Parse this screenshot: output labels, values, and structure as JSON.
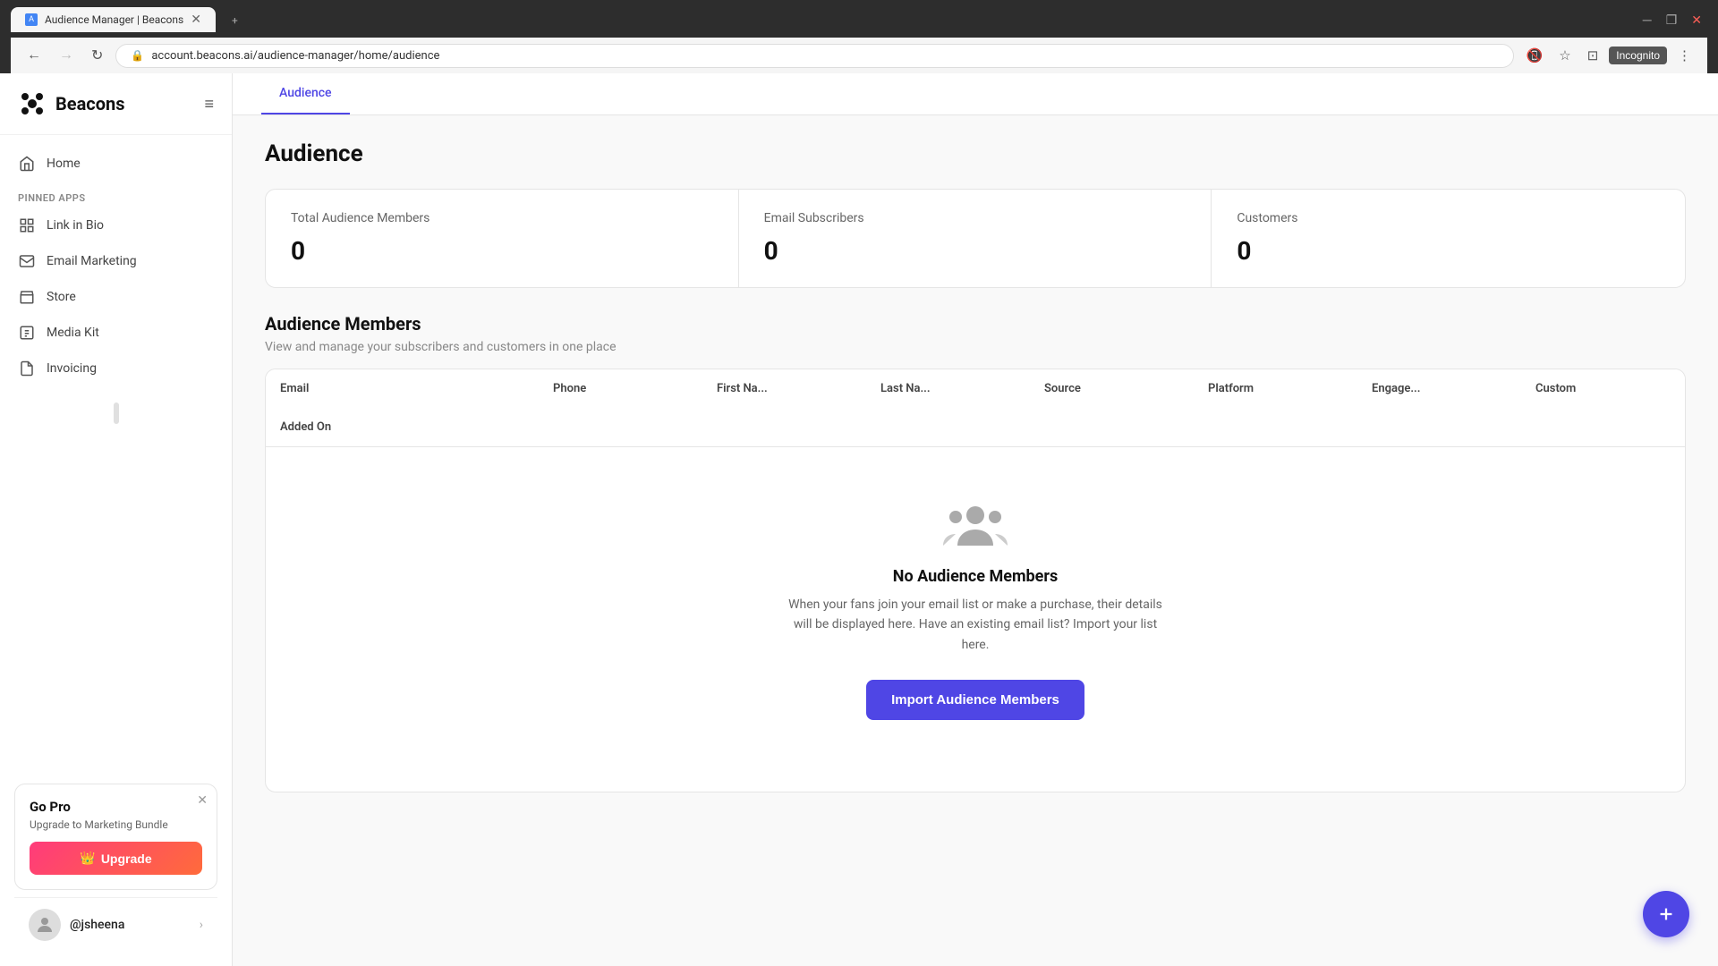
{
  "browser": {
    "tab_title": "Audience Manager | Beacons",
    "tab_favicon": "A",
    "url": "account.beacons.ai/audience-manager/home/audience",
    "incognito_label": "Incognito"
  },
  "sidebar": {
    "logo_text": "Beacons",
    "menu_toggle_icon": "≡",
    "pinned_label": "PINNED APPS",
    "nav_items": [
      {
        "id": "home",
        "label": "Home",
        "icon": "🏠"
      },
      {
        "id": "link-in-bio",
        "label": "Link in Bio",
        "icon": "⊞"
      },
      {
        "id": "email-marketing",
        "label": "Email Marketing",
        "icon": "✉"
      },
      {
        "id": "store",
        "label": "Store",
        "icon": "🏪"
      },
      {
        "id": "media-kit",
        "label": "Media Kit",
        "icon": "📋"
      },
      {
        "id": "invoicing",
        "label": "Invoicing",
        "icon": "📄"
      }
    ],
    "go_pro": {
      "title": "Go Pro",
      "subtitle": "Upgrade to Marketing Bundle",
      "upgrade_label": "Upgrade",
      "upgrade_icon": "👑"
    },
    "user": {
      "name": "@jsheena",
      "avatar_emoji": "👤"
    }
  },
  "top_nav": {
    "tabs": [
      {
        "id": "audience",
        "label": "Audience",
        "active": true
      }
    ]
  },
  "main": {
    "page_title": "Audience",
    "stats": {
      "total_audience": {
        "label": "Total Audience Members",
        "value": "0"
      },
      "email_subscribers": {
        "label": "Email Subscribers",
        "value": "0"
      },
      "customers": {
        "label": "Customers",
        "value": "0"
      }
    },
    "audience_members": {
      "title": "Audience Members",
      "subtitle": "View and manage your subscribers and customers in one place",
      "table_headers": [
        "Email",
        "Phone",
        "First Na...",
        "Last Na...",
        "Source",
        "Platform",
        "Engage...",
        "Custom",
        "Added On"
      ],
      "empty_state": {
        "title": "No Audience Members",
        "description": "When your fans join your email list or make a purchase, their details will be displayed here. Have an existing email list? Import your list here.",
        "import_button_label": "Import Audience Members"
      }
    }
  }
}
